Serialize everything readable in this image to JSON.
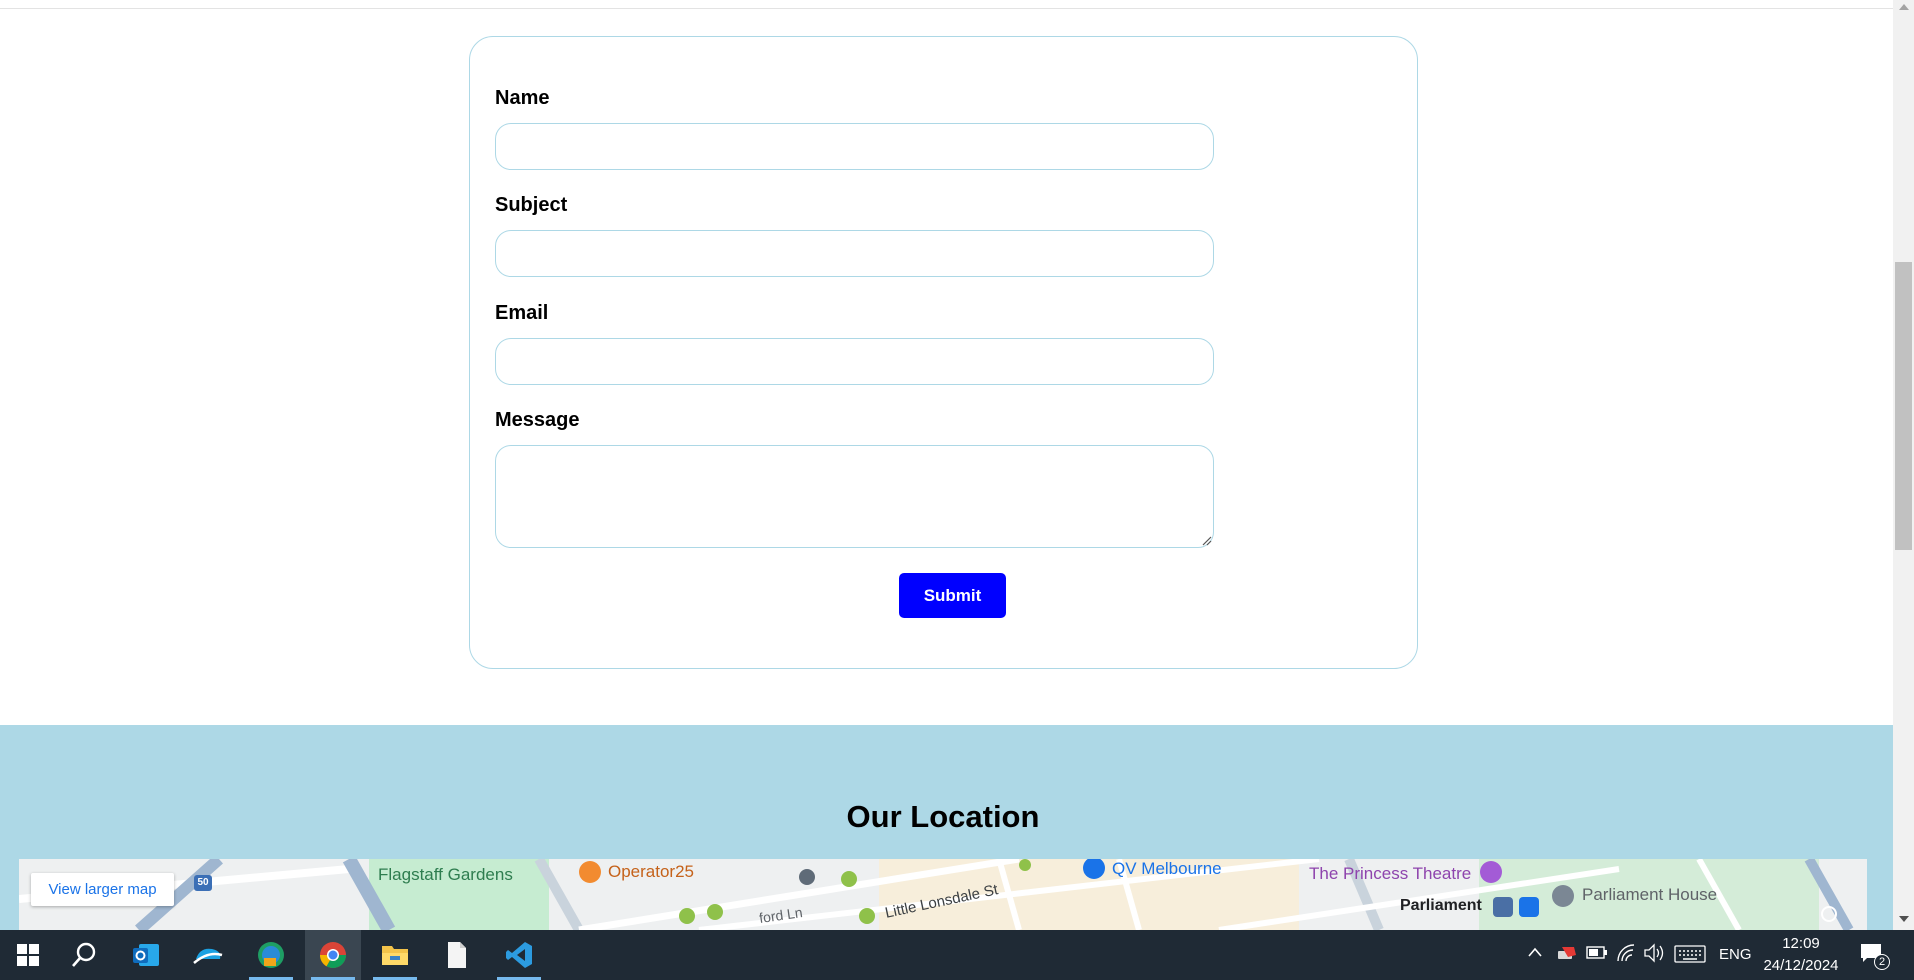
{
  "form": {
    "name_label": "Name",
    "subject_label": "Subject",
    "email_label": "Email",
    "message_label": "Message",
    "submit_label": "Submit"
  },
  "location": {
    "title": "Our Location",
    "view_larger_map": "View larger map",
    "labels": {
      "flagstaff": "Flagstaff Gardens",
      "operator25": "Operator25",
      "qv": "QV Melbourne",
      "princess": "The Princess Theatre",
      "parliament": "Parliament",
      "parliament_house": "Parliament House",
      "little_lonsdale": "Little Lonsdale St",
      "ford_ln": "ford Ln",
      "route_50": "50"
    }
  },
  "taskbar": {
    "language": "ENG",
    "time": "12:09",
    "date": "24/12/2024",
    "notification_count": "2"
  },
  "colors": {
    "accent_blue": "#0000ff",
    "section_bg": "#add8e6",
    "taskbar_bg": "#1f2a35"
  }
}
